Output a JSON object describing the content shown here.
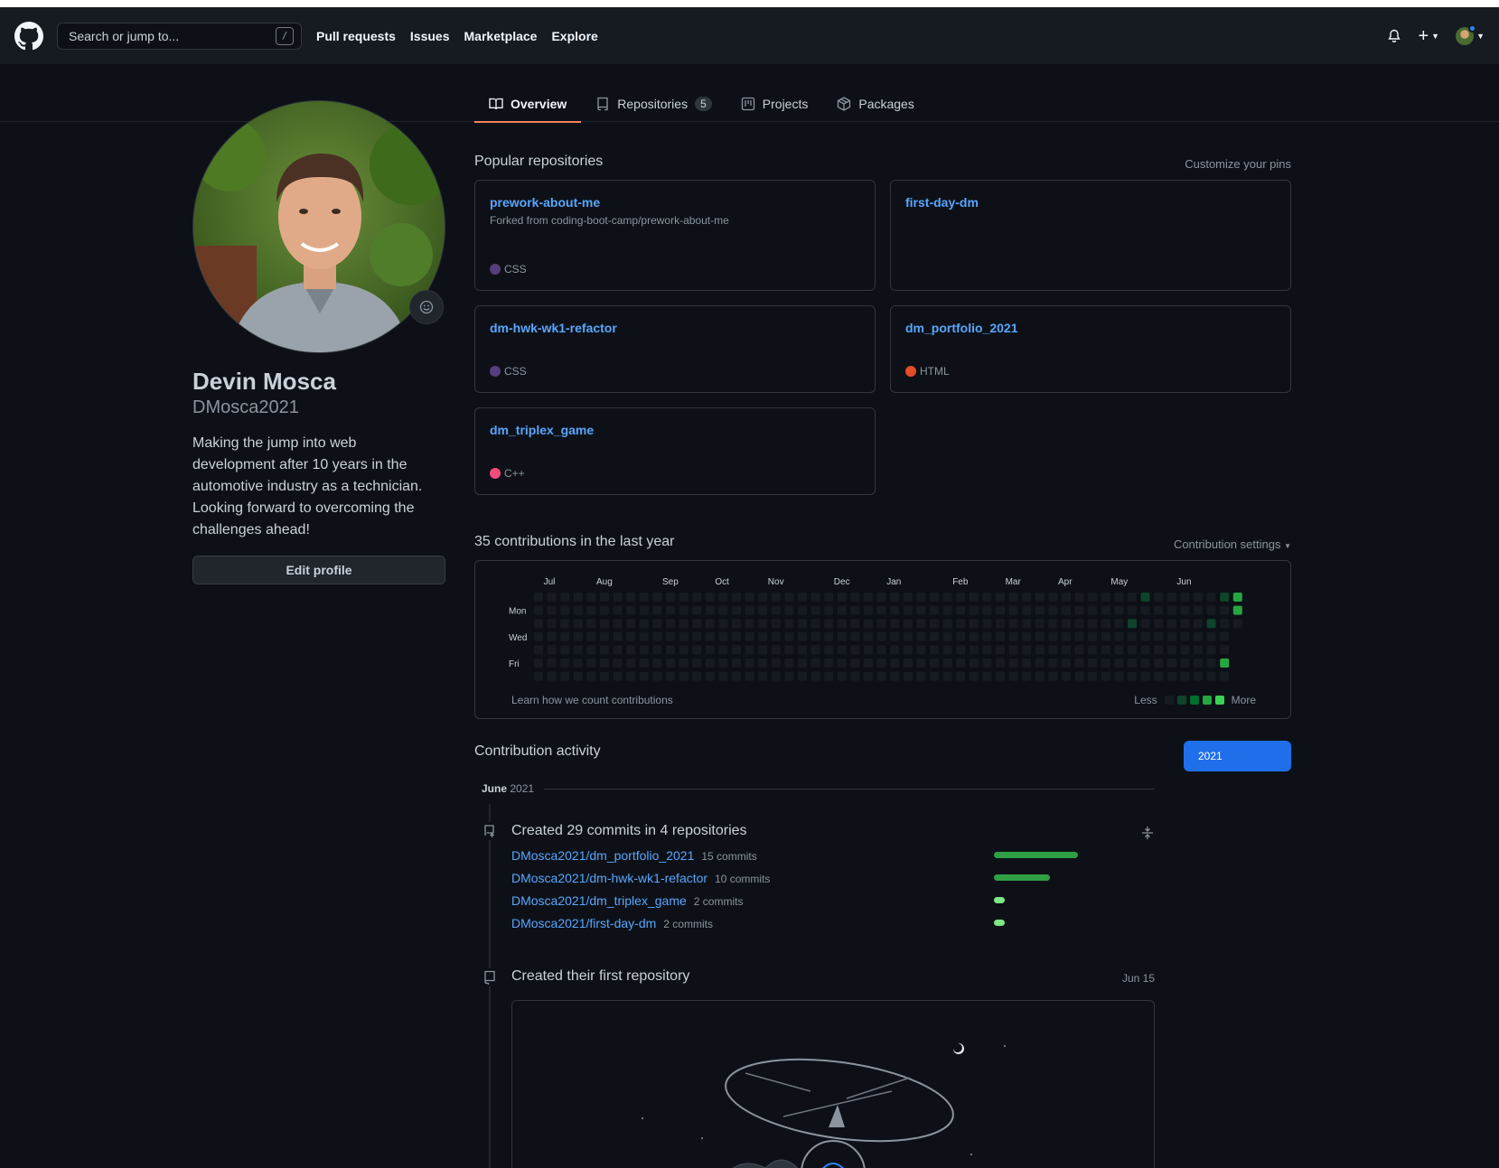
{
  "header": {
    "search_placeholder": "Search or jump to...",
    "search_shortcut": "/",
    "nav": [
      "Pull requests",
      "Issues",
      "Marketplace",
      "Explore"
    ],
    "plus_label": "+"
  },
  "tabs": [
    {
      "label": "Overview",
      "icon": "book-icon",
      "selected": true
    },
    {
      "label": "Repositories",
      "icon": "repo-icon",
      "count": "5"
    },
    {
      "label": "Projects",
      "icon": "project-icon"
    },
    {
      "label": "Packages",
      "icon": "package-icon"
    }
  ],
  "profile": {
    "name": "Devin Mosca",
    "login": "DMosca2021",
    "bio": "Making the jump into web development after 10 years in the automotive industry as a technician. Looking forward to overcoming the challenges ahead!",
    "edit_label": "Edit profile"
  },
  "popular": {
    "title": "Popular repositories",
    "customize": "Customize your pins",
    "pins": [
      {
        "name": "prework-about-me",
        "fork": "Forked from coding-boot-camp/prework-about-me",
        "lang": "CSS",
        "color": "#563d7c"
      },
      {
        "name": "first-day-dm",
        "fork": "",
        "lang": "",
        "color": ""
      },
      {
        "name": "dm-hwk-wk1-refactor",
        "fork": "",
        "lang": "CSS",
        "color": "#563d7c"
      },
      {
        "name": "dm_portfolio_2021",
        "fork": "",
        "lang": "HTML",
        "color": "#e34c26"
      },
      {
        "name": "dm_triplex_game",
        "fork": "",
        "lang": "C++",
        "color": "#f34b7d"
      }
    ]
  },
  "contributions": {
    "title": "35 contributions in the last year",
    "settings": "Contribution settings",
    "months": [
      "Jul",
      "Aug",
      "Sep",
      "Oct",
      "Nov",
      "Dec",
      "Jan",
      "Feb",
      "Mar",
      "Apr",
      "May",
      "Jun"
    ],
    "days": [
      "Mon",
      "Wed",
      "Fri"
    ],
    "learn": "Learn how we count contributions",
    "less": "Less",
    "more": "More",
    "level_colors": [
      "#161b22",
      "#0e4429",
      "#006d32",
      "#26a641",
      "#39d353"
    ],
    "filled_cells": [
      {
        "week": 46,
        "day": 0,
        "level": 1
      },
      {
        "week": 45,
        "day": 2,
        "level": 1
      },
      {
        "week": 52,
        "day": 0,
        "level": 1
      },
      {
        "week": 51,
        "day": 2,
        "level": 1
      },
      {
        "week": 52,
        "day": 5,
        "level": 3
      },
      {
        "week": 53,
        "day": 0,
        "level": 3
      },
      {
        "week": 53,
        "day": 1,
        "level": 3
      }
    ]
  },
  "activity": {
    "title": "Contribution activity",
    "year": "2021",
    "month": "June",
    "month_year": "2021",
    "commits_title": "Created 29 commits in 4 repositories",
    "commits": [
      {
        "repo": "DMosca2021/dm_portfolio_2021",
        "count": "15 commits",
        "value": 15
      },
      {
        "repo": "DMosca2021/dm-hwk-wk1-refactor",
        "count": "10 commits",
        "value": 10
      },
      {
        "repo": "DMosca2021/dm_triplex_game",
        "count": "2 commits",
        "value": 2
      },
      {
        "repo": "DMosca2021/first-day-dm",
        "count": "2 commits",
        "value": 2
      }
    ],
    "first_repo_title": "Created their first repository",
    "first_repo_date": "Jun 15"
  }
}
